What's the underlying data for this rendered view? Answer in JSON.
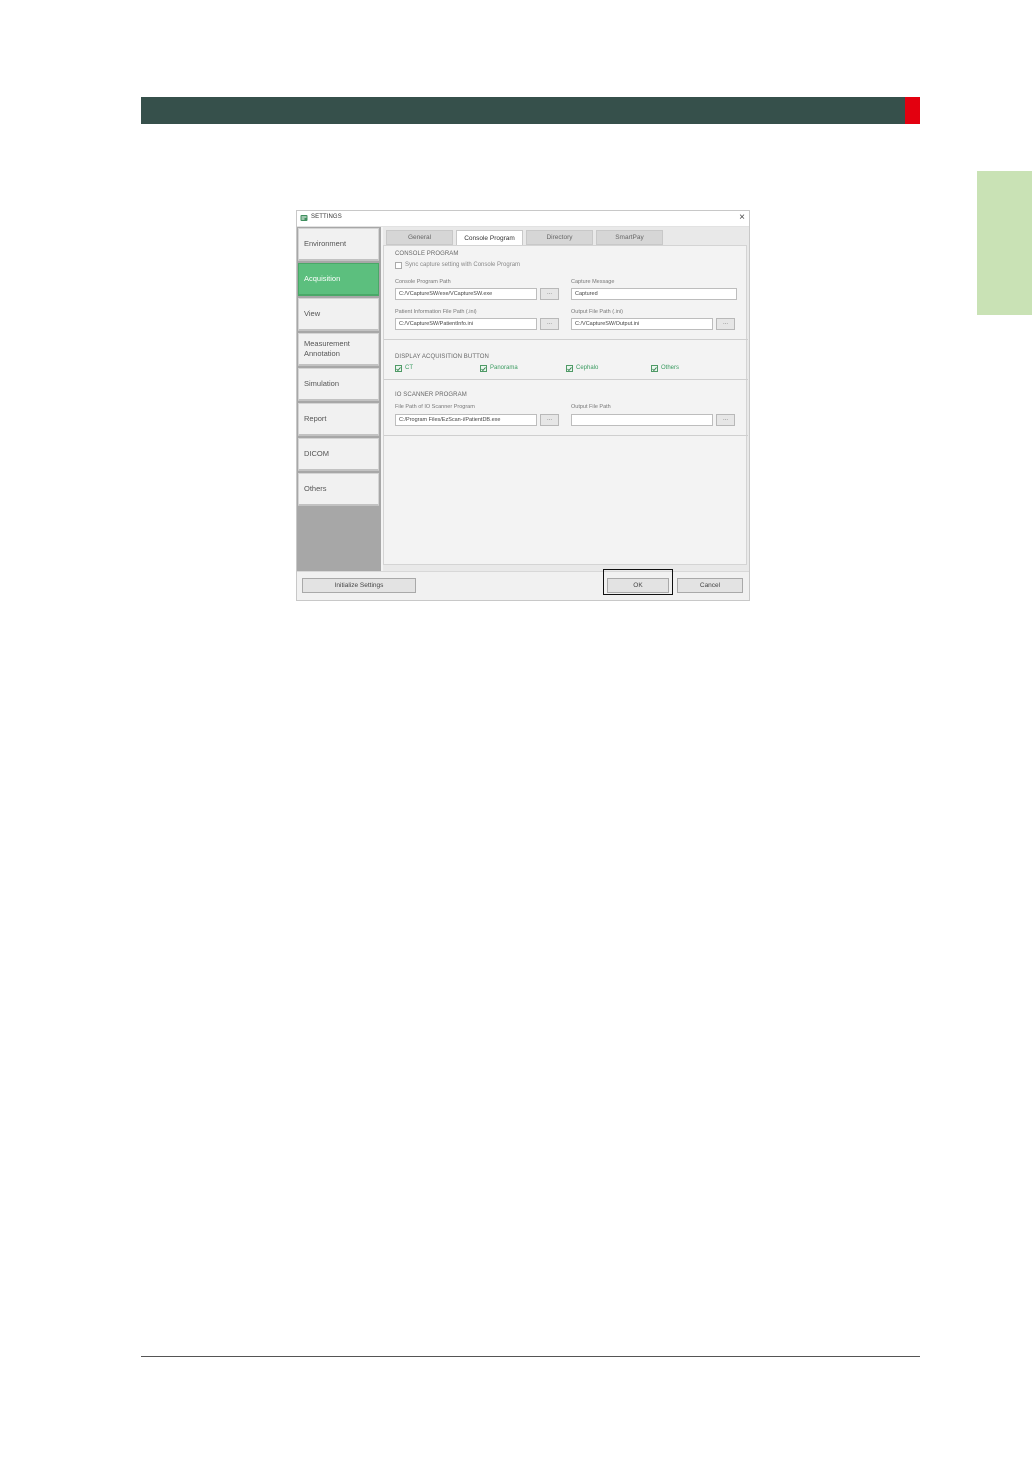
{
  "window": {
    "title": "SETTINGS",
    "close_glyph": "×",
    "icon": "settings-app-icon"
  },
  "sidebar": {
    "items": [
      {
        "label": "Environment"
      },
      {
        "label": "Acquisition",
        "active": true
      },
      {
        "label": "View"
      },
      {
        "label": "Measurement\nAnnotation"
      },
      {
        "label": "Simulation"
      },
      {
        "label": "Report"
      },
      {
        "label": "DICOM"
      },
      {
        "label": "Others"
      }
    ]
  },
  "tabs": [
    {
      "label": "General"
    },
    {
      "label": "Console Program",
      "active": true
    },
    {
      "label": "Directory"
    },
    {
      "label": "SmartPay"
    }
  ],
  "console_program": {
    "title": "CONSOLE PROGRAM",
    "sync_label": "Sync capture setting with Console Program",
    "sync_checked": false,
    "program_path_label": "Console Program Path",
    "program_path_value": "C:/VCaptureSW/exe/VCaptureSW.exe",
    "capture_message_label": "Capture Message",
    "capture_message_value": "Captured",
    "patient_info_label": "Patient Information File Path (.ini)",
    "patient_info_value": "C:/VCaptureSW/PatientInfo.ini",
    "output_path_label": "Output File Path (.ini)",
    "output_path_value": "C:/VCaptureSW/Output.ini"
  },
  "display_acquisition": {
    "title": "DISPLAY ACQUISITION BUTTON",
    "options": [
      {
        "label": "CT",
        "checked": true
      },
      {
        "label": "Panorama",
        "checked": true
      },
      {
        "label": "Cephalo",
        "checked": true
      },
      {
        "label": "Others",
        "checked": true
      }
    ]
  },
  "io_scanner": {
    "title": "IO SCANNER PROGRAM",
    "program_path_label": "File Path of IO Scanner Program",
    "program_path_value": "C:/Program Files/EzScan-i/PatientDB.exe",
    "output_path_label": "Output File Path",
    "output_path_value": ""
  },
  "browse_label": "...",
  "buttons": {
    "initialize": "Initialize Settings",
    "ok": "OK",
    "cancel": "Cancel"
  },
  "colors": {
    "header_bar": "#36504b",
    "header_accent": "#e3000f",
    "side_tab": "#c9e2b5",
    "active_nav": "#5cbf7e",
    "checkbox_label": "#3a9b60"
  }
}
